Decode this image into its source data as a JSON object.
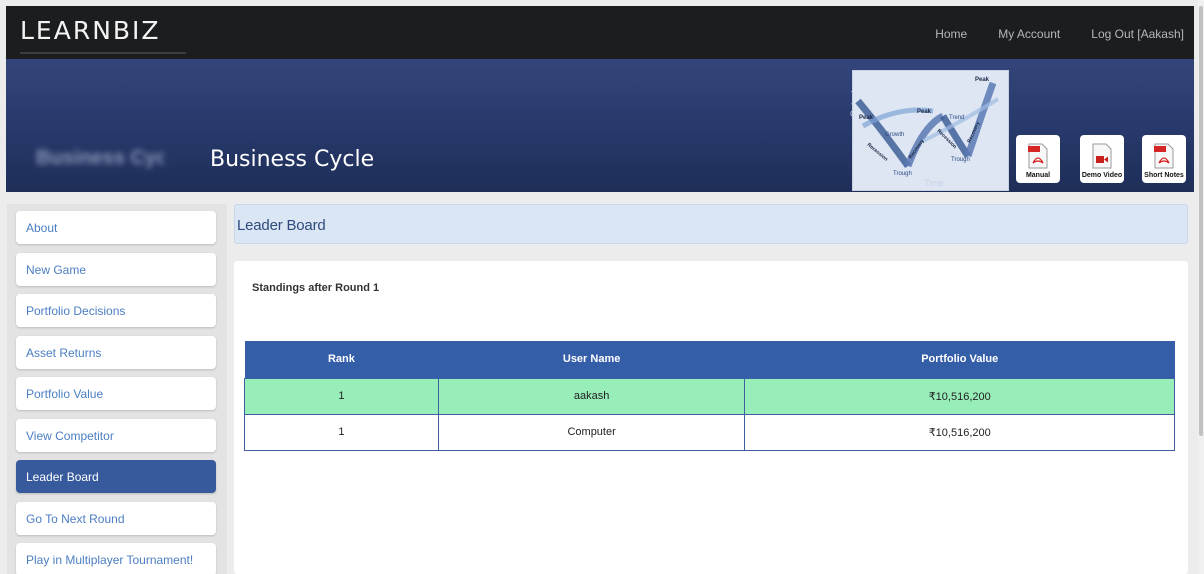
{
  "topnav": {
    "logo": "LEARNBIZ",
    "links": [
      "Home",
      "My Account",
      "Log Out [Aakash]"
    ]
  },
  "banner": {
    "ghost_title": "Business Cyc",
    "title": "Business Cycle",
    "cycle_image": {
      "output_label": "Output",
      "time_label": "Time",
      "labels": [
        "Peak",
        "Peak",
        "Peak",
        "Growth",
        "Trend",
        "Recession",
        "Recovery",
        "Recession",
        "Recovery",
        "Trough",
        "Trough"
      ]
    },
    "doc_buttons": [
      {
        "label": "Manual",
        "icon": "pdf-icon"
      },
      {
        "label": "Demo Video",
        "icon": "video-icon"
      },
      {
        "label": "Short Notes",
        "icon": "pdf-icon"
      }
    ]
  },
  "sidebar": {
    "items": [
      {
        "label": "About"
      },
      {
        "label": "New Game"
      },
      {
        "label": "Portfolio Decisions"
      },
      {
        "label": "Asset Returns"
      },
      {
        "label": "Portfolio Value"
      },
      {
        "label": "View Competitor"
      },
      {
        "label": "Leader Board"
      },
      {
        "label": "Go To Next Round"
      },
      {
        "label": "Play in Multiplayer Tournament!"
      }
    ],
    "active": "Leader Board"
  },
  "main": {
    "panel_title": "Leader Board",
    "standings": "Standings after Round 1",
    "table": {
      "headers": [
        "Rank",
        "User Name",
        "Portfolio Value"
      ],
      "rows": [
        {
          "rank": "1",
          "user": "aakash",
          "value": "₹10,516,200"
        },
        {
          "rank": "1",
          "user": "Computer",
          "value": "₹10,516,200"
        }
      ]
    }
  },
  "colors": {
    "topbar": "#1b1d1f",
    "banner": "#27396a",
    "accent": "#355ea9",
    "highlight_row": "#97eeb9",
    "link": "#4b7ec2"
  }
}
